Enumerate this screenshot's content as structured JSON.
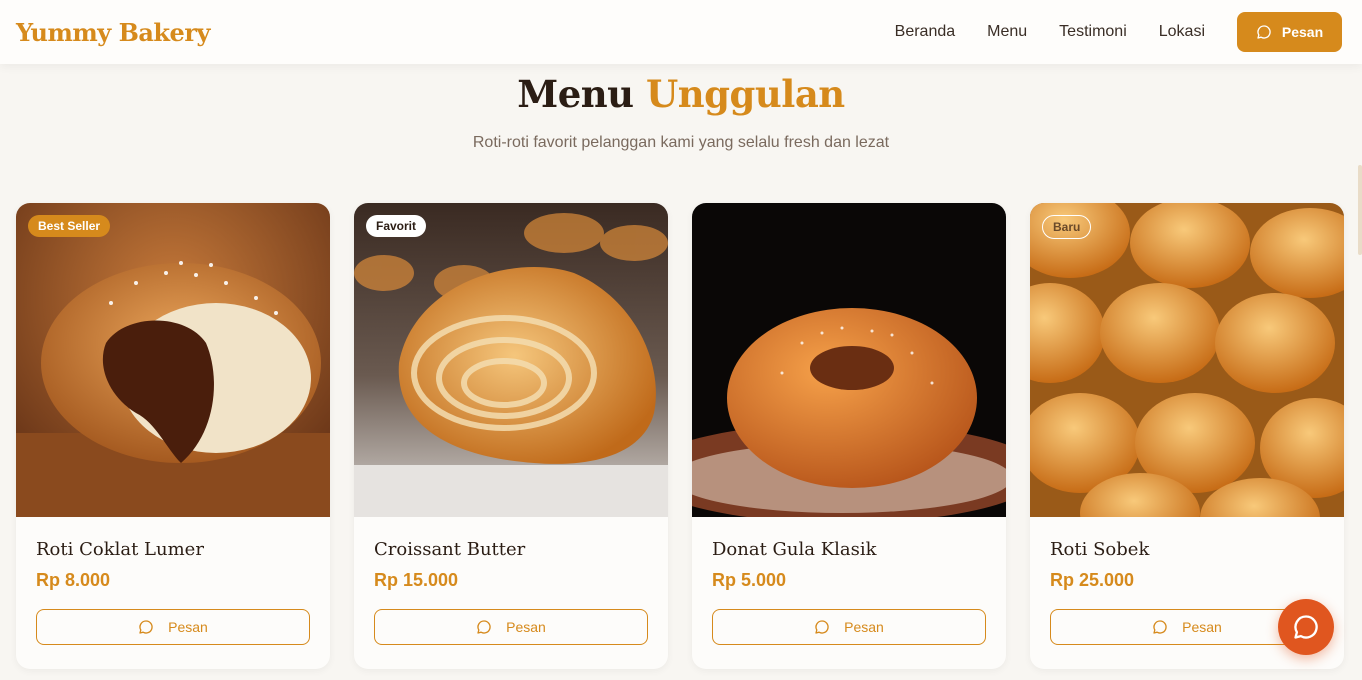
{
  "brand": "Yummy Bakery",
  "nav": {
    "links": [
      "Beranda",
      "Menu",
      "Testimoni",
      "Lokasi"
    ],
    "order_button": "Pesan",
    "order_icon": "chat-bubble-icon"
  },
  "section": {
    "title_main": "Menu",
    "title_accent": "Unggulan",
    "subtitle": "Roti-roti favorit pelanggan kami yang selalu fresh dan lezat"
  },
  "products": [
    {
      "name": "Roti Coklat Lumer",
      "price": "Rp 8.000",
      "badge": "Best Seller",
      "button": "Pesan"
    },
    {
      "name": "Croissant Butter",
      "price": "Rp 15.000",
      "badge": "Favorit",
      "button": "Pesan"
    },
    {
      "name": "Donat Gula Klasik",
      "price": "Rp 5.000",
      "badge": "",
      "button": "Pesan"
    },
    {
      "name": "Roti Sobek",
      "price": "Rp 25.000",
      "badge": "Baru",
      "button": "Pesan"
    }
  ],
  "colors": {
    "accent": "#d68a1c",
    "fab": "#e0561f",
    "background": "#f8f6f2"
  },
  "fab_icon": "chat-bubble-icon"
}
